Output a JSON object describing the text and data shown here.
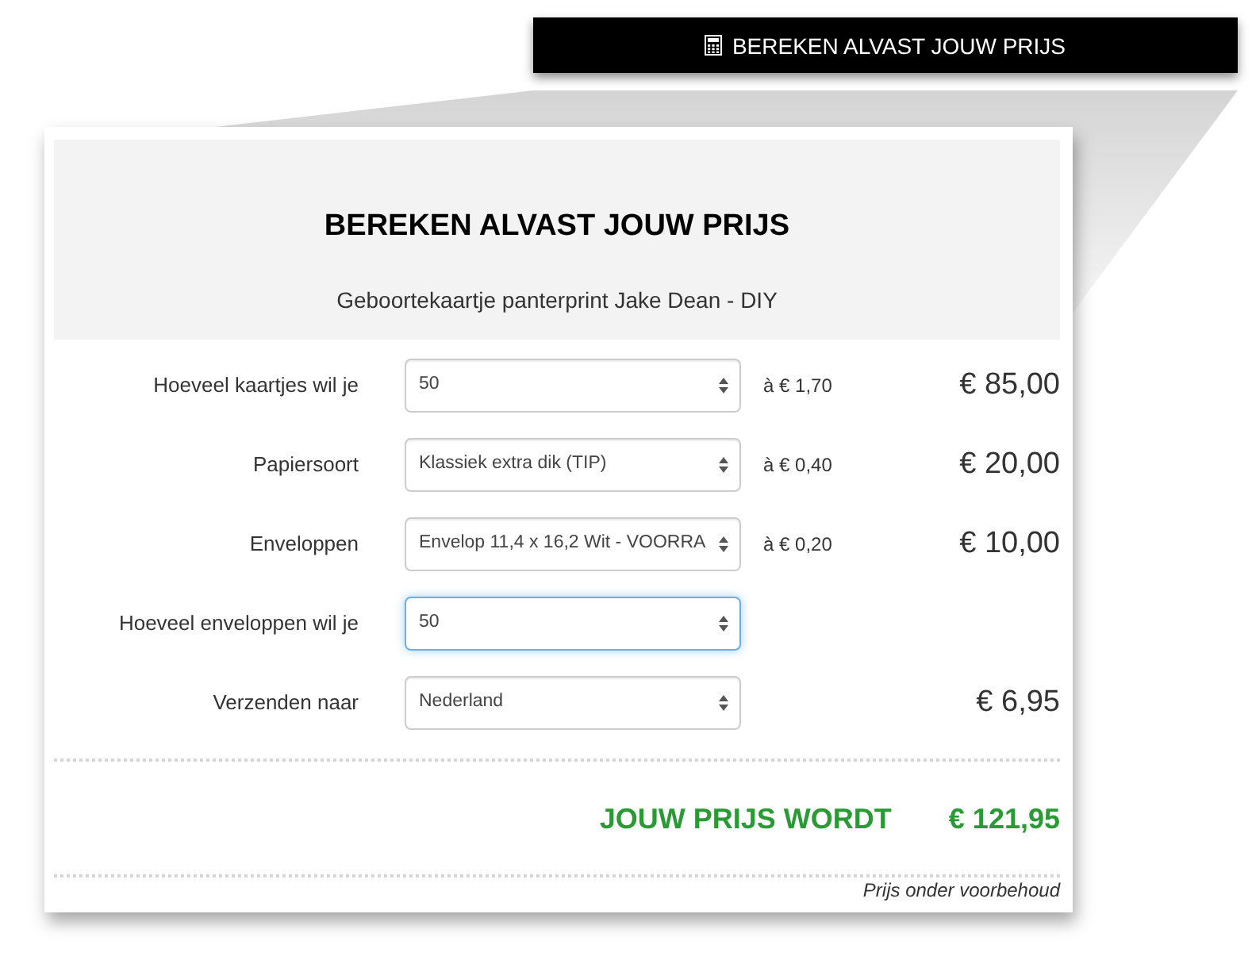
{
  "banner": {
    "title": "BEREKEN ALVAST JOUW PRIJS"
  },
  "card": {
    "title": "BEREKEN ALVAST JOUW PRIJS",
    "subtitle": "Geboortekaartje panterprint Jake Dean - DIY"
  },
  "rows": [
    {
      "label": "Hoeveel kaartjes wil je",
      "value": "50",
      "focused": false,
      "unit_price": "à € 1,70",
      "amount": "€ 85,00"
    },
    {
      "label": "Papiersoort",
      "value": "Klassiek extra dik (TIP)",
      "focused": false,
      "unit_price": "à € 0,40",
      "amount": "€ 20,00"
    },
    {
      "label": "Enveloppen",
      "value": "Envelop 11,4 x 16,2 Wit - VOORRA",
      "focused": false,
      "unit_price": "à € 0,20",
      "amount": "€ 10,00"
    },
    {
      "label": "Hoeveel enveloppen wil je",
      "value": "50",
      "focused": true
    },
    {
      "label": "Verzenden naar",
      "value": "Nederland",
      "focused": false,
      "amount": "€ 6,95"
    }
  ],
  "total": {
    "label": "JOUW PRIJS WORDT",
    "amount": "€ 121,95"
  },
  "disclaimer": "Prijs onder voorbehoud"
}
